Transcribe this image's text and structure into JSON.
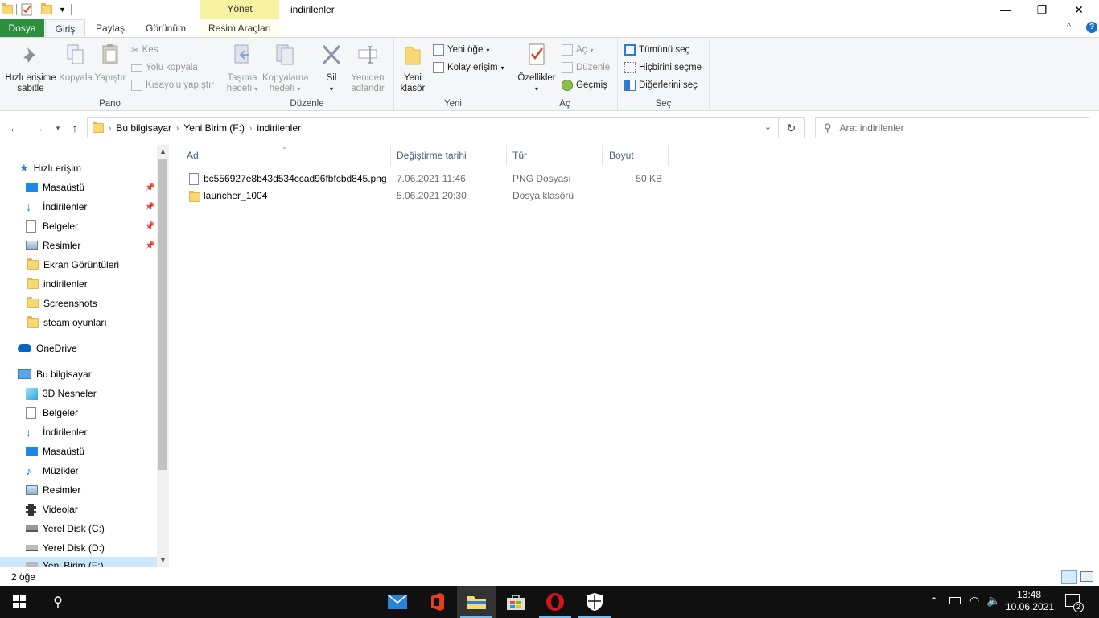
{
  "window": {
    "title": "indirilenler",
    "contextual_tab_group": "Yönet",
    "minimize_glyph": "—",
    "maximize_glyph": "❐",
    "close_glyph": "✕"
  },
  "ribbon_tabs": {
    "file": "Dosya",
    "home": "Giriş",
    "share": "Paylaş",
    "view": "Görünüm",
    "picture_tools": "Resim Araçları"
  },
  "ribbon": {
    "clipboard": {
      "label": "Pano",
      "pin_line1": "Hızlı erişime",
      "pin_line2": "sabitle",
      "copy": "Kopyala",
      "paste": "Yapıştır",
      "cut": "Kes",
      "copy_path": "Yolu kopyala",
      "paste_shortcut": "Kısayolu yapıştır"
    },
    "organize": {
      "label": "Düzenle",
      "move_line1": "Taşıma",
      "move_line2": "hedefi",
      "copyto_line1": "Kopyalama",
      "copyto_line2": "hedefi",
      "delete": "Sil",
      "rename_line1": "Yeniden",
      "rename_line2": "adlandır"
    },
    "new": {
      "label": "Yeni",
      "newfolder_line1": "Yeni",
      "newfolder_line2": "klasör",
      "new_item": "Yeni öğe",
      "easy_access": "Kolay erişim"
    },
    "open": {
      "label": "Aç",
      "properties": "Özellikler",
      "open": "Aç",
      "edit": "Düzenle",
      "history": "Geçmiş"
    },
    "select": {
      "label": "Seç",
      "select_all": "Tümünü seç",
      "select_none": "Hiçbirini seçme",
      "invert": "Diğerlerini seç"
    }
  },
  "address": {
    "crumbs": [
      "Bu bilgisayar",
      "Yeni Birim (F:)",
      "indirilenler"
    ],
    "search_placeholder": "Ara: indirilenler"
  },
  "nav_pane": {
    "quick_access": "Hızlı erişim",
    "quick_items": [
      "Masaüstü",
      "İndirilenler",
      "Belgeler",
      "Resimler",
      "Ekran Görüntüleri",
      "indirilenler",
      "Screenshots",
      "steam oyunları"
    ],
    "onedrive": "OneDrive",
    "this_pc": "Bu bilgisayar",
    "pc_items": [
      "3D Nesneler",
      "Belgeler",
      "İndirilenler",
      "Masaüstü",
      "Müzikler",
      "Resimler",
      "Videolar",
      "Yerel Disk (C:)",
      "Yerel Disk (D:)",
      "Yeni Birim (F:)"
    ]
  },
  "file_list": {
    "columns": [
      "Ad",
      "Değiştirme tarihi",
      "Tür",
      "Boyut"
    ],
    "rows": [
      {
        "name": "bc556927e8b43d534ccad96fbfcbd845.png",
        "date": "7.06.2021 11:46",
        "type": "PNG Dosyası",
        "size": "50 KB"
      },
      {
        "name": "launcher_1004",
        "date": "5.06.2021 20:30",
        "type": "Dosya klasörü",
        "size": ""
      }
    ]
  },
  "status": {
    "item_count": "2 öğe"
  },
  "taskbar": {
    "time": "13:48",
    "date": "10.06.2021",
    "notification_count": "2"
  }
}
